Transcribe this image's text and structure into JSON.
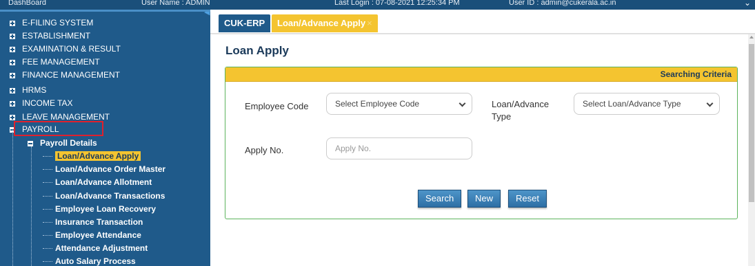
{
  "topbar": {
    "dashboard": "DashBoard",
    "user_name": "User Name : ADMIN",
    "last_login": "Last Login : 07-08-2021 12:25:34 PM",
    "user_id": "User ID : admin@cukerala.ac.in"
  },
  "sidebar": {
    "modules": [
      "E-FILING SYSTEM",
      "ESTABLISHMENT",
      "EXAMINATION & RESULT",
      "FEE MANAGEMENT",
      "FINANCE MANAGEMENT",
      "HRMS",
      "INCOME TAX",
      "LEAVE MANAGEMENT",
      "PAYROLL"
    ],
    "payroll_group": "Payroll Details",
    "payroll_items": [
      "Loan/Advance Apply",
      "Loan/Advance Order Master",
      "Loan/Advance Allotment",
      "Loan/Advance Transactions",
      "Employee Loan Recovery",
      "Insurance Transaction",
      "Employee Attendance",
      "Attendance Adjustment",
      "Auto Salary Process"
    ]
  },
  "tabs": [
    {
      "label": "CUK-ERP"
    },
    {
      "label": "Loan/Advance Apply",
      "close": "×"
    }
  ],
  "page": {
    "title": "Loan Apply",
    "panel_title": "Searching Criteria",
    "employee_code_label": "Employee Code",
    "employee_code_value": "Select Employee Code",
    "loan_type_label_1": "Loan/Advance",
    "loan_type_label_2": "Type",
    "loan_type_value": "Select Loan/Advance Type",
    "apply_no_label": "Apply No.",
    "apply_no_placeholder": "Apply No.",
    "buttons": {
      "search": "Search",
      "new": "New",
      "reset": "Reset"
    }
  },
  "colors": {
    "sidebar_bg": "#1f5a8a",
    "accent_yellow": "#f4c430",
    "panel_border": "#5bb35b",
    "highlight_red": "#e0202c"
  }
}
